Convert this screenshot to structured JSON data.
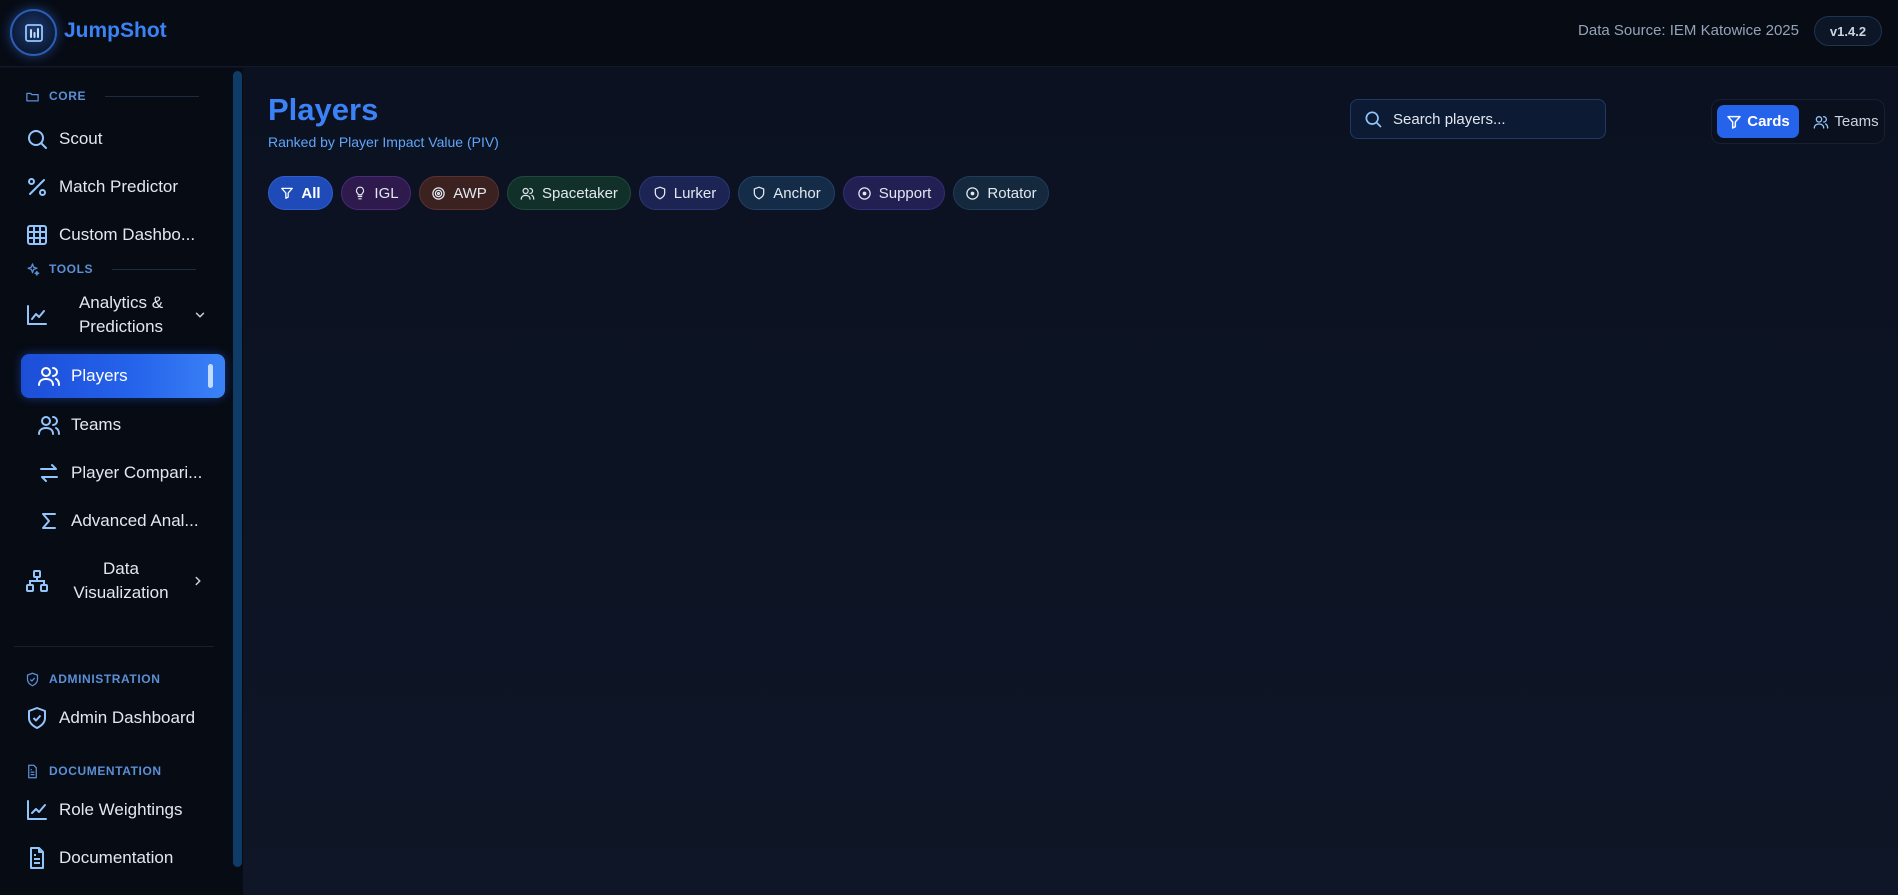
{
  "app": {
    "brand": "JumpShot",
    "data_source": "Data Source: IEM Katowice 2025",
    "version": "v1.4.2",
    "accent": "#3b82f6"
  },
  "sidebar": {
    "sections": [
      {
        "title": "CORE",
        "icon": "folder-icon"
      },
      {
        "title": "TOOLS",
        "icon": "sparkles-icon"
      },
      {
        "title": "ADMINISTRATION",
        "icon": "shield-check-icon"
      },
      {
        "title": "DOCUMENTATION",
        "icon": "file-text-icon"
      }
    ],
    "core_items": [
      {
        "label": "Scout",
        "icon": "search-icon"
      },
      {
        "label": "Match Predictor",
        "icon": "percent-icon"
      },
      {
        "label": "Custom Dashbo...",
        "icon": "grid-icon"
      }
    ],
    "tools_group": {
      "label": "Analytics & Predictions",
      "line1": "Analytics &",
      "line2": "Predictions",
      "icon": "chart-area-icon",
      "expanded": true
    },
    "tools_items": [
      {
        "label": "Players",
        "icon": "users-icon",
        "active": true
      },
      {
        "label": "Teams",
        "icon": "users-icon"
      },
      {
        "label": "Player Compari...",
        "icon": "arrows-left-right-icon"
      },
      {
        "label": "Advanced Anal...",
        "icon": "sigma-icon"
      }
    ],
    "viz_group": {
      "label": "Data Visualization",
      "line1": "Data",
      "line2": "Visualization",
      "icon": "network-icon",
      "expanded": false
    },
    "admin_items": [
      {
        "label": "Admin Dashboard",
        "icon": "shield-check-icon"
      }
    ],
    "doc_items": [
      {
        "label": "Role Weightings",
        "icon": "line-chart-icon"
      },
      {
        "label": "Documentation",
        "icon": "file-text-icon"
      }
    ]
  },
  "main": {
    "title": "Players",
    "subtitle": "Ranked by Player Impact Value (PIV)",
    "search": {
      "placeholder": "Search players...",
      "value": ""
    },
    "view_toggle": {
      "cards": "Cards",
      "teams": "Teams",
      "selected": "Cards"
    },
    "role_filters": [
      {
        "label": "All",
        "icon": "filter-icon",
        "selected": true
      },
      {
        "label": "IGL",
        "icon": "lightbulb-icon"
      },
      {
        "label": "AWP",
        "icon": "target-icon"
      },
      {
        "label": "Spacetaker",
        "icon": "users-icon"
      },
      {
        "label": "Lurker",
        "icon": "shield-icon"
      },
      {
        "label": "Anchor",
        "icon": "shield-icon"
      },
      {
        "label": "Support",
        "icon": "circle-dot-icon"
      },
      {
        "label": "Rotator",
        "icon": "circle-dot-icon"
      }
    ]
  }
}
